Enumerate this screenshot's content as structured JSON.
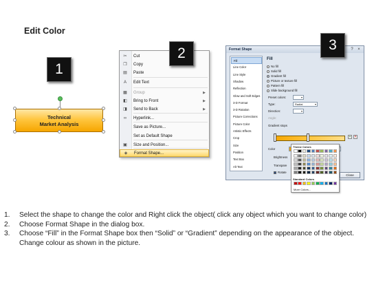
{
  "title": "Edit Color",
  "steps": [
    "1",
    "2",
    "3"
  ],
  "shape": {
    "line1": "Technical",
    "line2": "Market Analysis",
    "fill_color": "#ffc640",
    "border_color": "#a96e00"
  },
  "context_menu": {
    "items": [
      {
        "icon": "scissors-icon",
        "glyph": "✂",
        "label": "Cut",
        "disabled": false,
        "submenu": false
      },
      {
        "icon": "copy-icon",
        "glyph": "❐",
        "label": "Copy",
        "disabled": false,
        "submenu": false
      },
      {
        "icon": "paste-icon",
        "glyph": "▤",
        "label": "Paste",
        "disabled": false,
        "submenu": false
      },
      {
        "icon": "edit-text-icon",
        "glyph": "A",
        "label": "Edit Text",
        "disabled": false,
        "submenu": false
      },
      {
        "icon": "group-icon",
        "glyph": "▦",
        "label": "Group",
        "disabled": true,
        "submenu": true
      },
      {
        "icon": "bring-to-front-icon",
        "glyph": "◧",
        "label": "Bring to Front",
        "disabled": false,
        "submenu": true
      },
      {
        "icon": "send-to-back-icon",
        "glyph": "◨",
        "label": "Send to Back",
        "disabled": false,
        "submenu": true
      },
      {
        "icon": "hyperlink-icon",
        "glyph": "∞",
        "label": "Hyperlink...",
        "disabled": false,
        "submenu": false
      },
      {
        "icon": "",
        "glyph": "",
        "label": "Save as Picture...",
        "disabled": false,
        "submenu": false
      },
      {
        "icon": "",
        "glyph": "",
        "label": "Set as Default Shape",
        "disabled": false,
        "submenu": false
      },
      {
        "icon": "size-position-icon",
        "glyph": "▣",
        "label": "Size and Position...",
        "disabled": false,
        "submenu": false
      },
      {
        "icon": "format-shape-icon",
        "glyph": "◈",
        "label": "Format Shape...",
        "disabled": false,
        "submenu": false,
        "highlighted": true
      }
    ]
  },
  "dialog": {
    "title": "Format Shape",
    "help": "?",
    "close_glyph": "×",
    "categories": [
      "Fill",
      "Line Color",
      "Line Style",
      "Shadow",
      "Reflection",
      "Glow and Soft Edges",
      "3-D Format",
      "3-D Rotation",
      "Picture Corrections",
      "Picture Color",
      "Artistic Effects",
      "Crop",
      "Size",
      "Position",
      "Text Box",
      "Alt Text"
    ],
    "selected_category": "Fill",
    "fill_heading": "Fill",
    "fill_options": [
      "No fill",
      "Solid fill",
      "Gradient fill",
      "Picture or texture fill",
      "Pattern fill",
      "Slide background fill"
    ],
    "selected_fill": "Gradient fill",
    "preset_colors_label": "Preset colors:",
    "type_label": "Type:",
    "type_value": "Radial",
    "direction_label": "Direction:",
    "angle_label": "Angle:",
    "gradient_stops_label": "Gradient stops",
    "color_label": "Color",
    "position_label": "Position:",
    "position_value": "0%",
    "brightness_label": "Brightness",
    "transparency_label": "Transpare",
    "rotate_label": "Rotate",
    "close_button": "Close",
    "palette": {
      "theme_heading": "Theme Colors",
      "standard_heading": "Standard Colors",
      "more_label": "More Colors...",
      "theme_rows": [
        [
          "#ffffff",
          "#000000",
          "#eeece1",
          "#1f497d",
          "#4f81bd",
          "#c0504d",
          "#9bbb59",
          "#8064a2",
          "#4bacc6",
          "#f79646"
        ],
        [
          "#f2f2f2",
          "#7f7f7f",
          "#ddd9c3",
          "#c6d9f0",
          "#dbe5f1",
          "#f2dcdb",
          "#ebf1dd",
          "#e5e0ec",
          "#dbeef3",
          "#fdeada"
        ],
        [
          "#d8d8d8",
          "#595959",
          "#c4bd97",
          "#8db3e2",
          "#b8cce4",
          "#e5b9b7",
          "#d7e3bc",
          "#ccc1d9",
          "#b7dde8",
          "#fbd5b5"
        ],
        [
          "#bfbfbf",
          "#3f3f3f",
          "#938953",
          "#548dd4",
          "#95b3d7",
          "#d99694",
          "#c3d69b",
          "#b2a2c7",
          "#92cddc",
          "#fac08f"
        ],
        [
          "#a5a5a5",
          "#262626",
          "#494429",
          "#17365d",
          "#366092",
          "#953734",
          "#76923c",
          "#5f497a",
          "#31859b",
          "#e36c09"
        ],
        [
          "#7f7f7f",
          "#0c0c0c",
          "#1d1b10",
          "#0f243e",
          "#244061",
          "#632423",
          "#4f6128",
          "#3f3151",
          "#205867",
          "#974806"
        ]
      ],
      "standard_row": [
        "#c00000",
        "#ff0000",
        "#ffc000",
        "#ffff00",
        "#92d050",
        "#00b050",
        "#00b0f0",
        "#0070c0",
        "#002060",
        "#7030a0"
      ]
    }
  },
  "instructions": [
    {
      "num": "1.",
      "text": "Select the shape to change the color and Right click the object( click any object which you want to change color)"
    },
    {
      "num": "2.",
      "text": "Choose Format Shape in the dialog box."
    },
    {
      "num": "3.",
      "text": "Choose “Fill” in the Format Shape box then “Solid” or “Gradient” depending on the appearance of the object. Change colour as shown in the picture."
    }
  ]
}
